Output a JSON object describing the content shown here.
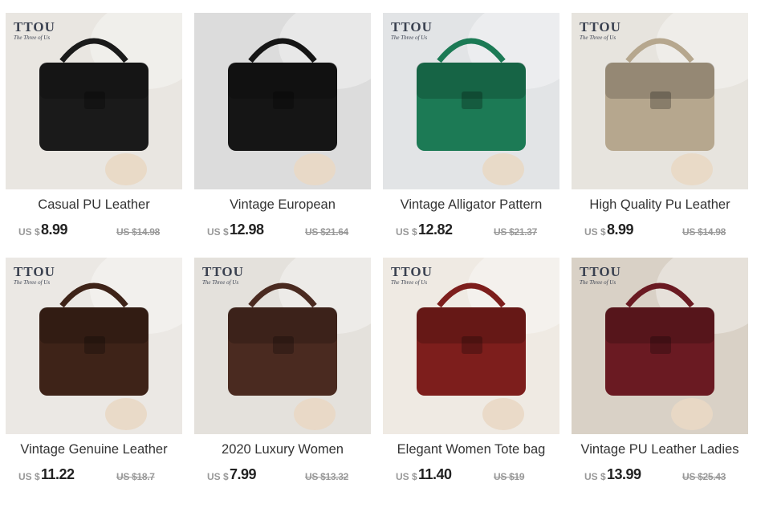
{
  "products": [
    {
      "title": "Casual PU Leather",
      "currency": "US $",
      "price": "8.99",
      "old_price": "US $14.98",
      "brand": "TTOU",
      "brand_sub": "The Three of Us",
      "color": "#1a1a1a",
      "bg": "#e9e6e1"
    },
    {
      "title": "Vintage European",
      "currency": "US $",
      "price": "12.98",
      "old_price": "US $21.64",
      "brand": "",
      "brand_sub": "",
      "color": "#151515",
      "bg": "#dcdcdc"
    },
    {
      "title": "Vintage Alligator Pattern",
      "currency": "US $",
      "price": "12.82",
      "old_price": "US $21.37",
      "brand": "TTOU",
      "brand_sub": "The Three of Us",
      "color": "#1c7a55",
      "bg": "#e2e4e6"
    },
    {
      "title": "High Quality Pu Leather",
      "currency": "US $",
      "price": "8.99",
      "old_price": "US $14.98",
      "brand": "TTOU",
      "brand_sub": "The Three of Us",
      "color": "#b6a78e",
      "bg": "#e7e4de"
    },
    {
      "title": "Vintage Genuine Leather",
      "currency": "US $",
      "price": "11.22",
      "old_price": "US $18.7",
      "brand": "TTOU",
      "brand_sub": "The Three of Us",
      "color": "#3e2318",
      "bg": "#ebe8e4"
    },
    {
      "title": "2020 Luxury Women",
      "currency": "US $",
      "price": "7.99",
      "old_price": "US $13.32",
      "brand": "TTOU",
      "brand_sub": "The Three of Us",
      "color": "#4a2a20",
      "bg": "#e4e1dc"
    },
    {
      "title": "Elegant Women Tote bag",
      "currency": "US $",
      "price": "11.40",
      "old_price": "US $19",
      "brand": "TTOU",
      "brand_sub": "The Three of Us",
      "color": "#7d1e1c",
      "bg": "#efeae3"
    },
    {
      "title": "Vintage PU Leather Ladies",
      "currency": "US $",
      "price": "13.99",
      "old_price": "US $25.43",
      "brand": "TTOU",
      "brand_sub": "The Three of Us",
      "color": "#6a1a22",
      "bg": "#d9d1c6"
    }
  ]
}
